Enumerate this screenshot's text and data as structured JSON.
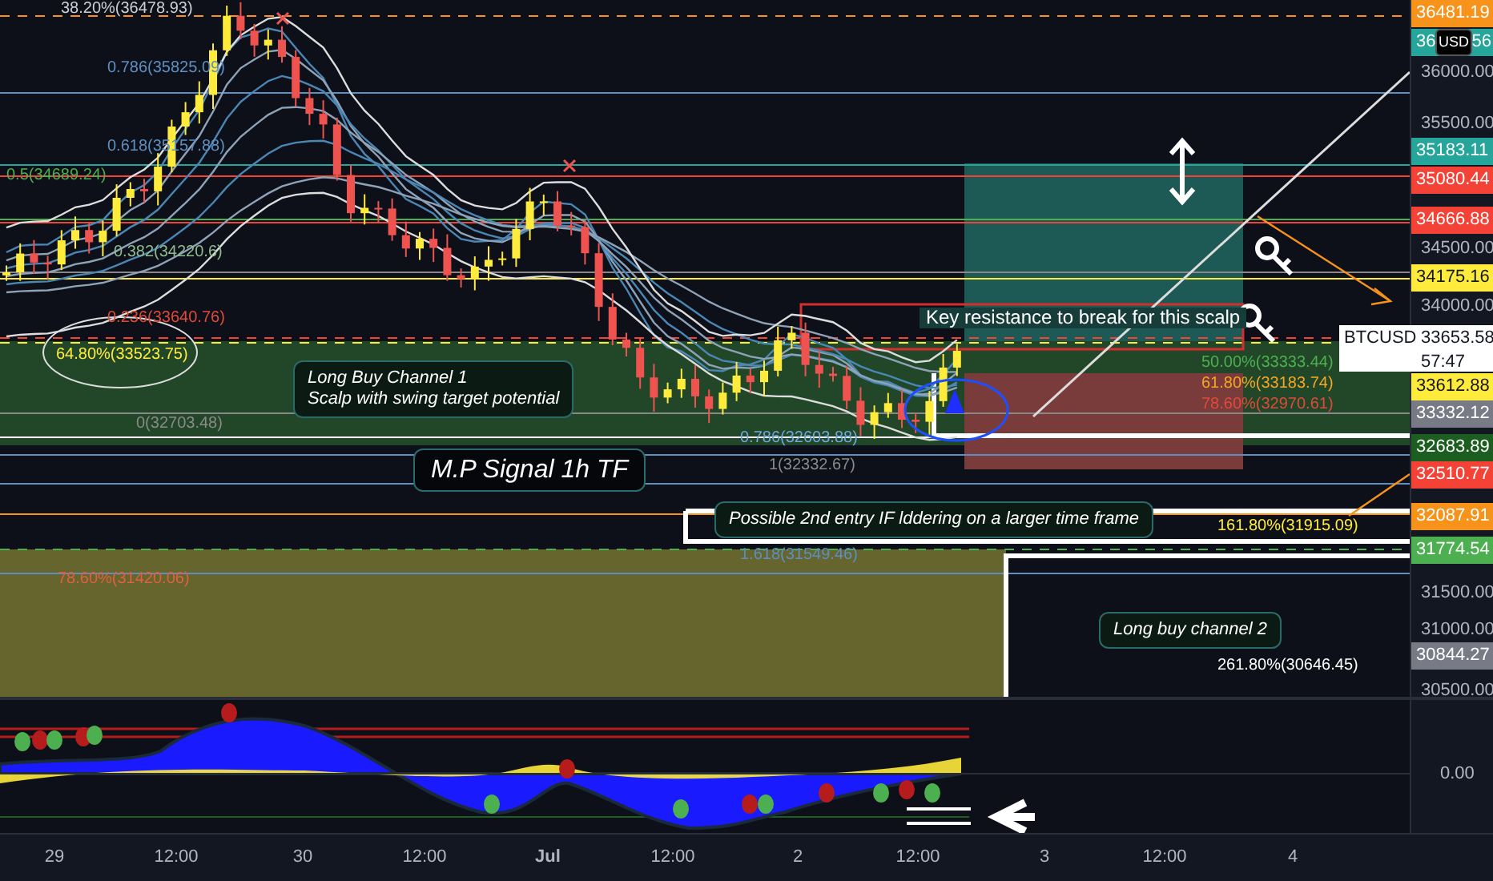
{
  "price_axis": {
    "currency": "USD",
    "ticks": [
      "36000.00",
      "35500.00",
      "34500.00",
      "34000.00",
      "31500.00",
      "31000.00",
      "30500.00"
    ]
  },
  "price_tags": [
    {
      "text": "36481.19",
      "color": "#f7931a"
    },
    {
      "text": "36",
      "text_after": "56",
      "color": "#26a69a"
    },
    {
      "text": "35183.11",
      "color": "#26a69a"
    },
    {
      "text": "35080.44",
      "color": "#f44336"
    },
    {
      "text": "34666.88",
      "color": "#f44336"
    },
    {
      "text": "34175.16",
      "color": "#ffeb3b"
    },
    {
      "text": "33612.88",
      "color": "#ffeb3b"
    },
    {
      "text": "33332.12",
      "color": "#787b86"
    },
    {
      "text": "32683.89",
      "color": "#1b5e20"
    },
    {
      "text": "32510.77",
      "color": "#f44336"
    },
    {
      "text": "32087.91",
      "color": "#f7931a"
    },
    {
      "text": "31774.54",
      "color": "#4caf50"
    },
    {
      "text": "30844.27",
      "color": "#787b86"
    }
  ],
  "symbol_tag": {
    "symbol": "BTCUSD",
    "price": "33653.58",
    "countdown": "57:47"
  },
  "fib_labels": [
    {
      "text": "38.20%(36478.93)",
      "color": "#cfcfcf"
    },
    {
      "text": "0.786(35825.09)",
      "color": "#5d8fc0"
    },
    {
      "text": "0.618(35157.88)",
      "color": "#5d8fc0"
    },
    {
      "text": "0.5(34689.24)",
      "color": "#4caf50"
    },
    {
      "text": "0.382(34220.6)",
      "color": "#8fbc8f"
    },
    {
      "text": "0.236(33640.76)",
      "color": "#e04a3a"
    },
    {
      "text": "64.80%(33523.75)",
      "color": "#ffeb3b"
    },
    {
      "text": "0(32703.48)",
      "color": "#8a8a8a"
    },
    {
      "text": "0.786(32603.88)",
      "color": "#6fa8dc"
    },
    {
      "text": "1(32332.67)",
      "color": "#8a8a8a"
    },
    {
      "text": "50.00%(33333.44)",
      "color": "#4caf50"
    },
    {
      "text": "61.80%(33183.74)",
      "color": "#f5a623"
    },
    {
      "text": "78.60%(32970.61)",
      "color": "#e04a3a"
    },
    {
      "text": "161.80%(31915.09)",
      "color": "#ffeb3b"
    },
    {
      "text": "1.618(31549.46)",
      "color": "#5d8fc0"
    },
    {
      "text": "78.60%(31420.06)",
      "color": "#e06040"
    },
    {
      "text": "261.80%(30646.45)",
      "color": "#ffffff"
    }
  ],
  "callouts": [
    {
      "kind": "note",
      "lines": [
        "Long Buy Channel 1",
        "Scalp with swing target potential"
      ]
    },
    {
      "kind": "signal",
      "lines": [
        "M.P Signal 1h TF"
      ]
    },
    {
      "kind": "plain",
      "lines": [
        "Key resistance to break for this scalp"
      ]
    },
    {
      "kind": "note",
      "lines": [
        "Possible 2nd entry IF lddering on a larger time frame"
      ]
    },
    {
      "kind": "note",
      "lines": [
        "Long buy channel 2"
      ]
    }
  ],
  "indicator_axis": {
    "ticks": [
      "0.00"
    ]
  },
  "time_axis": [
    "29",
    "12:00",
    "30",
    "12:00",
    "Jul",
    "12:00",
    "2",
    "12:00",
    "3",
    "12:00",
    "4"
  ]
}
